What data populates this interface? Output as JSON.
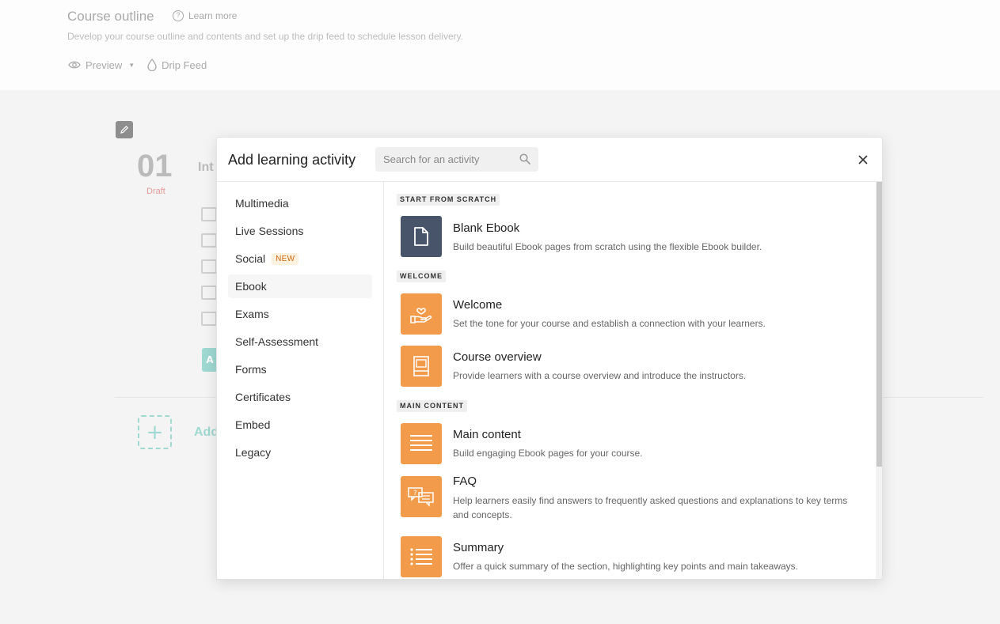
{
  "background": {
    "title": "Course outline",
    "learn_more": "Learn more",
    "subtitle": "Develop your course outline and contents and set up the drip feed to schedule lesson delivery.",
    "preview_label": "Preview",
    "drip_feed_label": "Drip Feed",
    "lesson_number": "01",
    "lesson_status": "Draft",
    "lesson_title_partial": "Int",
    "add_button_partial": "A",
    "add_section_partial": "Add"
  },
  "modal": {
    "title": "Add learning activity",
    "search_placeholder": "Search for an activity",
    "categories": [
      {
        "label": "Multimedia"
      },
      {
        "label": "Live Sessions"
      },
      {
        "label": "Social",
        "badge": "NEW"
      },
      {
        "label": "Ebook",
        "active": true
      },
      {
        "label": "Exams"
      },
      {
        "label": "Self-Assessment"
      },
      {
        "label": "Forms"
      },
      {
        "label": "Certificates"
      },
      {
        "label": "Embed"
      },
      {
        "label": "Legacy"
      }
    ],
    "sections": {
      "scratch": "START FROM SCRATCH",
      "welcome": "WELCOME",
      "main": "MAIN CONTENT"
    },
    "activities": {
      "blank_ebook": {
        "title": "Blank Ebook",
        "desc": "Build beautiful Ebook pages from scratch using the flexible Ebook builder.",
        "icon": "file-icon"
      },
      "welcome": {
        "title": "Welcome",
        "desc": "Set the tone for your course and establish a connection with your learners.",
        "icon": "heart-hand-icon"
      },
      "course_overview": {
        "title": "Course overview",
        "desc": "Provide learners with a course overview and introduce the instructors.",
        "icon": "book-icon"
      },
      "main_content": {
        "title": "Main content",
        "desc": "Build engaging Ebook pages for your course.",
        "icon": "lines-icon"
      },
      "faq": {
        "title": "FAQ",
        "desc": "Help learners easily find answers to frequently asked questions and explanations to key terms and concepts.",
        "icon": "chat-bubbles-icon"
      },
      "summary": {
        "title": "Summary",
        "desc": "Offer a quick summary of the section, highlighting key points and main takeaways.",
        "icon": "list-icon"
      }
    }
  },
  "colors": {
    "accent_orange": "#f29b4b",
    "dark_icon": "#48546a",
    "teal": "#9fd9d2",
    "badge_bg": "#fdf1df",
    "badge_text": "#c96a12"
  }
}
